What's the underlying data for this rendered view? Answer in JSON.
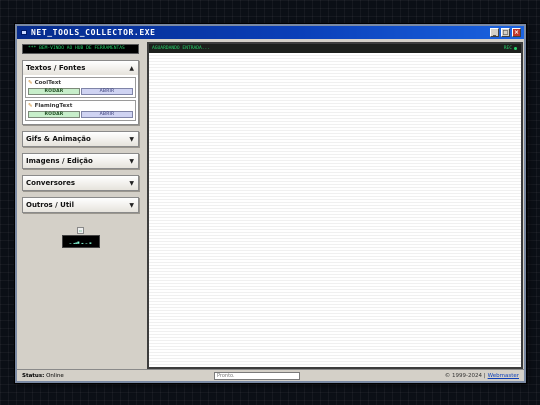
{
  "window": {
    "title": "NET_TOOLS_COLLECTOR.EXE",
    "buttons": {
      "minimize": "_",
      "maximize": "□",
      "close": "×"
    }
  },
  "sidebar": {
    "marquee_text": "*** BEM-VINDO AO HUB DE FERRAMENTAS",
    "categories": [
      {
        "label": "Textos / Fontes",
        "expanded": true,
        "tools": [
          {
            "name": "CoolText",
            "run_label": "RODAR",
            "open_label": "ABRIR"
          },
          {
            "name": "FlamingText",
            "run_label": "RODAR",
            "open_label": "ABRIR"
          }
        ]
      },
      {
        "label": "Gifs & Animação",
        "expanded": false
      },
      {
        "label": "Imagens / Edição",
        "expanded": false
      },
      {
        "label": "Conversores",
        "expanded": false
      },
      {
        "label": "Outros / Util",
        "expanded": false
      }
    ],
    "badge_text": "▁ ▂▃▅ ▂ ▁ ▃"
  },
  "main": {
    "status_text": "AGUARDANDO ENTRADA...",
    "indicator_text": "REC"
  },
  "statusbar": {
    "status_label": "Status:",
    "status_value": "Online",
    "input_placeholder": "Pronto.",
    "copyright": "© 1999-2024 |",
    "webmaster_label": "Webmaster"
  },
  "colors": {
    "title_gradient_start": "#062b8c",
    "title_gradient_end": "#1b63e0",
    "terminal_green": "#27d36b",
    "run_button": "#c7eeca",
    "open_button": "#cfd3f2"
  },
  "icons": {
    "app": "window-app-icon",
    "tool": "pencil-icon",
    "category_toggle": "chevron-icon",
    "indicator": "status-dot-icon",
    "badge_image": "broken-image-icon"
  }
}
